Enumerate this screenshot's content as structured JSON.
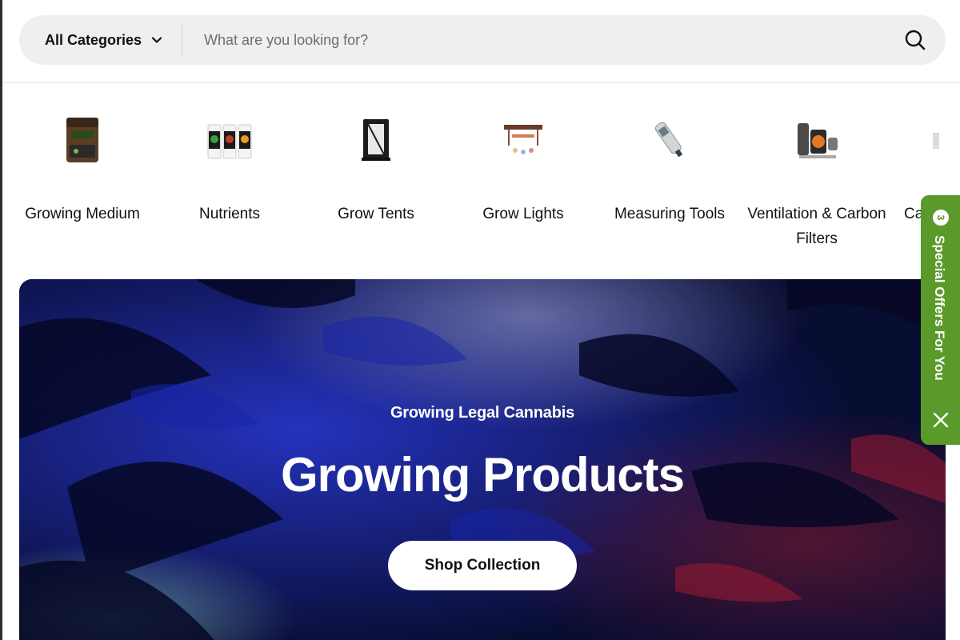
{
  "search": {
    "category_label": "All Categories",
    "placeholder": "What are you looking for?",
    "search_icon": "search-icon",
    "chevron_icon": "chevron-down-icon"
  },
  "categories": [
    {
      "label": "Growing Medium",
      "icon": "soil-bag-image"
    },
    {
      "label": "Nutrients",
      "icon": "nutrient-bottles-image"
    },
    {
      "label": "Grow Tents",
      "icon": "grow-tent-image"
    },
    {
      "label": "Grow Lights",
      "icon": "grow-light-image"
    },
    {
      "label": "Measuring Tools",
      "icon": "ph-meter-image"
    },
    {
      "label": "Ventilation & Carbon Filters",
      "icon": "fan-filter-image"
    },
    {
      "label": "Ca",
      "icon": "partial-category-image"
    }
  ],
  "hero": {
    "subtitle": "Growing Legal Cannabis",
    "title": "Growing Products",
    "button_label": "Shop Collection"
  },
  "side_tab": {
    "badge": "3",
    "label": "Special Offers For You",
    "close_icon": "close-icon",
    "color": "#5a9a2a"
  },
  "colors": {
    "search_bg": "#efefef",
    "hero_overlay": "#0b1550"
  }
}
